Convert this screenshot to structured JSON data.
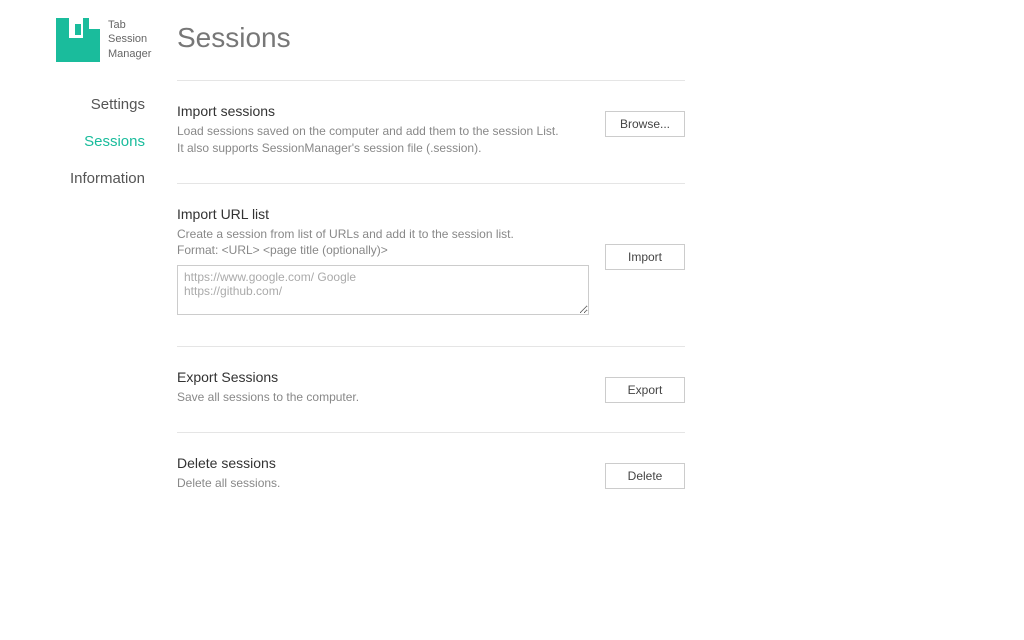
{
  "app": {
    "name_line1": "Tab",
    "name_line2": "Session",
    "name_line3": "Manager"
  },
  "nav": {
    "settings": "Settings",
    "sessions": "Sessions",
    "information": "Information"
  },
  "page": {
    "title": "Sessions"
  },
  "sections": {
    "import_sessions": {
      "title": "Import sessions",
      "desc": "Load sessions saved on the computer and add them to the session List.\nIt also supports SessionManager's session file (.session).",
      "button": "Browse..."
    },
    "import_url": {
      "title": "Import URL list",
      "desc": "Create a session from list of URLs and add it to the session list.\nFormat: <URL>  <page title (optionally)>",
      "placeholder": "https://www.google.com/ Google\nhttps://github.com/",
      "button": "Import"
    },
    "export": {
      "title": "Export Sessions",
      "desc": "Save all sessions to the computer.",
      "button": "Export"
    },
    "delete": {
      "title": "Delete sessions",
      "desc": "Delete all sessions.",
      "button": "Delete"
    }
  }
}
